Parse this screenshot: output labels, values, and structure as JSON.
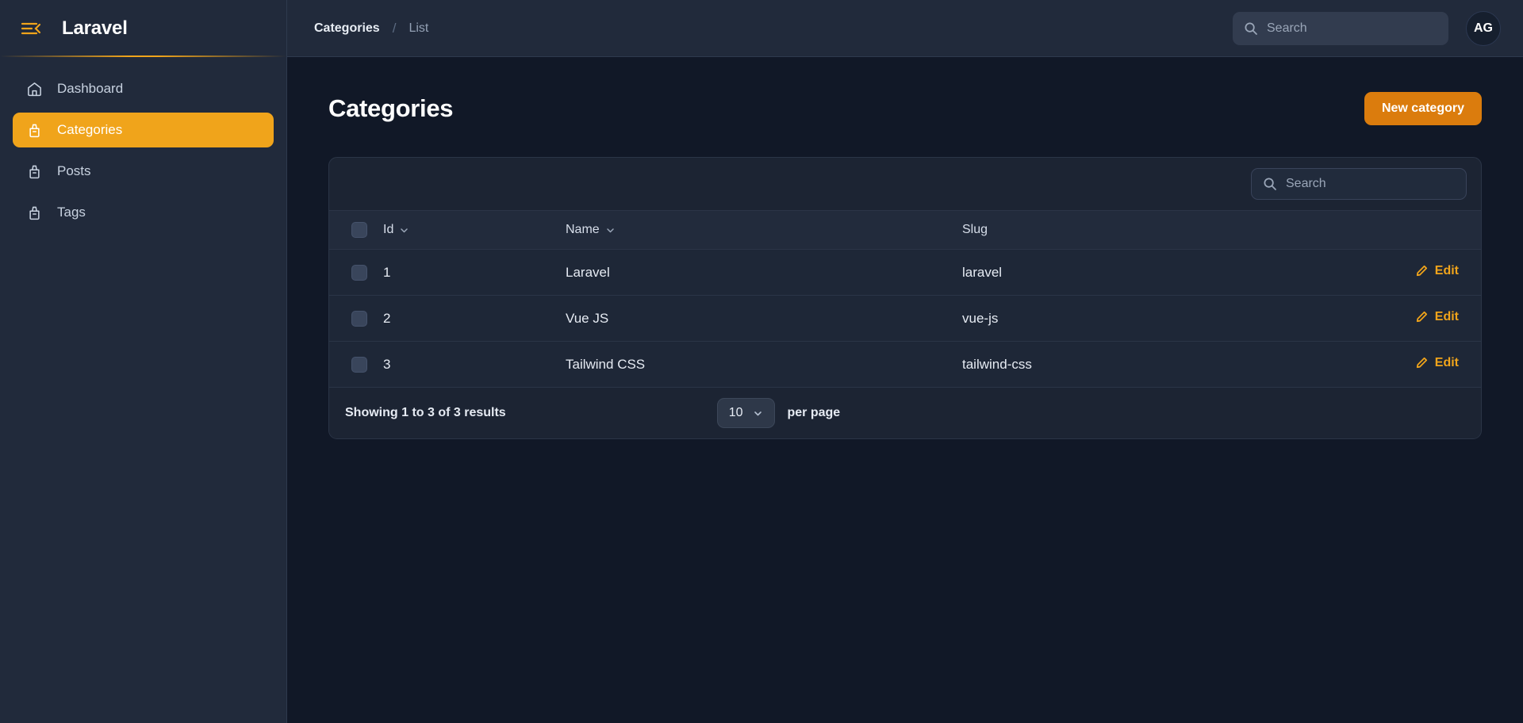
{
  "brand": {
    "name": "Laravel",
    "collapse_icon": "menu-collapse-icon"
  },
  "sidebar": {
    "items": [
      {
        "label": "Dashboard",
        "icon": "home-icon",
        "active": false
      },
      {
        "label": "Categories",
        "icon": "archive-box-icon",
        "active": true
      },
      {
        "label": "Posts",
        "icon": "archive-box-icon",
        "active": false
      },
      {
        "label": "Tags",
        "icon": "archive-box-icon",
        "active": false
      }
    ]
  },
  "topbar": {
    "breadcrumb": {
      "root": "Categories",
      "separator": "/",
      "current": "List"
    },
    "search": {
      "value": "",
      "placeholder": "Search",
      "icon": "search-icon"
    },
    "avatar": {
      "initials": "AG"
    }
  },
  "page": {
    "title": "Categories",
    "new_button": "New category"
  },
  "table": {
    "search": {
      "value": "",
      "placeholder": "Search",
      "icon": "search-icon"
    },
    "columns": [
      {
        "key": "check",
        "label": "",
        "sortable": false
      },
      {
        "key": "id",
        "label": "Id",
        "sortable": true
      },
      {
        "key": "name",
        "label": "Name",
        "sortable": true
      },
      {
        "key": "slug",
        "label": "Slug",
        "sortable": false
      },
      {
        "key": "action",
        "label": "",
        "sortable": false
      }
    ],
    "rows": [
      {
        "id": "1",
        "name": "Laravel",
        "slug": "laravel",
        "action": "Edit"
      },
      {
        "id": "2",
        "name": "Vue JS",
        "slug": "vue-js",
        "action": "Edit"
      },
      {
        "id": "3",
        "name": "Tailwind CSS",
        "slug": "tailwind-css",
        "action": "Edit"
      }
    ],
    "footer": {
      "showing": "Showing 1 to 3 of 3 results",
      "per_page_value": "10",
      "per_page_label": "per page"
    }
  },
  "colors": {
    "accent_orange": "#f0a41b",
    "button_orange": "#db7c0d",
    "sidebar_bg": "#212a3b",
    "content_bg": "#111827",
    "card_bg": "#1c2433",
    "row_bg": "#1e2737",
    "border": "#2b3547"
  }
}
